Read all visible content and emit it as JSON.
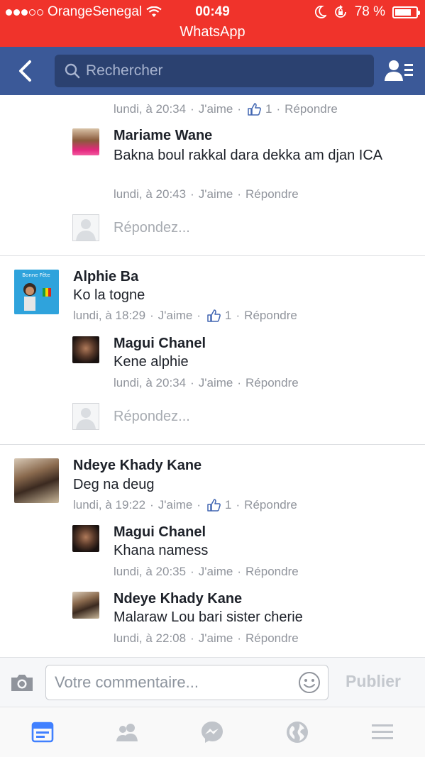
{
  "status_bar": {
    "carrier": "OrangeSenegal",
    "time": "00:49",
    "battery": "78 %",
    "battery_level": 0.78,
    "back_to_app": "WhatsApp",
    "colors": {
      "background": "#f0332b"
    }
  },
  "navbar": {
    "search_placeholder": "Rechercher",
    "colors": {
      "background": "#3b5998",
      "search_bg": "#2b4170"
    }
  },
  "feed": {
    "top_partial_meta": {
      "time": "lundi, à 20:34",
      "like": "J'aime",
      "like_count": "1",
      "reply": "Répondre"
    },
    "threads": [
      {
        "replies": [
          {
            "name": "Mariame Wane",
            "text": "Bakna boul rakkal dara dekka am djan ICA",
            "time": "lundi, à 20:43",
            "like": "J'aime",
            "reply": "Répondre"
          }
        ],
        "reply_placeholder": "Répondez..."
      },
      {
        "comment": {
          "name": "Alphie Ba",
          "text": "Ko la togne",
          "time": "lundi, à 18:29",
          "like": "J'aime",
          "like_count": "1",
          "reply": "Répondre",
          "avatar_caption": "Bonne Fête"
        },
        "replies": [
          {
            "name": "Magui Chanel",
            "text": "Kene alphie",
            "time": "lundi, à 20:34",
            "like": "J'aime",
            "reply": "Répondre"
          }
        ],
        "reply_placeholder": "Répondez..."
      },
      {
        "comment": {
          "name": "Ndeye Khady Kane",
          "text": "Deg na deug",
          "time": "lundi, à 19:22",
          "like": "J'aime",
          "like_count": "1",
          "reply": "Répondre"
        },
        "replies": [
          {
            "name": "Magui Chanel",
            "text": "Khana namess",
            "time": "lundi, à 20:35",
            "like": "J'aime",
            "reply": "Répondre"
          },
          {
            "name": "Ndeye Khady Kane",
            "text": "Malaraw Lou bari sister cherie",
            "time": "lundi, à 22:08",
            "like": "J'aime",
            "reply": "Répondre"
          }
        ]
      }
    ]
  },
  "comment_bar": {
    "placeholder": "Votre commentaire...",
    "publish": "Publier"
  },
  "tab_bar": {
    "icons": [
      "news-feed-icon",
      "friends-icon",
      "messenger-icon",
      "notifications-globe-icon",
      "menu-icon"
    ],
    "active_color": "#4080ff",
    "inactive_color": "#c0c4ca"
  },
  "separator": "·"
}
